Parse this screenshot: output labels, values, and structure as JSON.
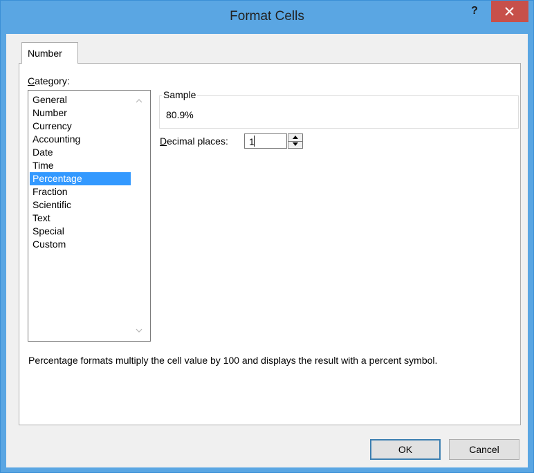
{
  "window": {
    "title": "Format Cells",
    "help_label": "?",
    "accent_color": "#5aa6e3",
    "close_color": "#c7504a"
  },
  "tabs": [
    {
      "label": "Number",
      "selected": true
    }
  ],
  "category": {
    "label": "Category:",
    "label_underlined_char": "C",
    "label_rest": "ategory:",
    "selected": "Percentage",
    "items": [
      "General",
      "Number",
      "Currency",
      "Accounting",
      "Date",
      "Time",
      "Percentage",
      "Fraction",
      "Scientific",
      "Text",
      "Special",
      "Custom"
    ]
  },
  "sample": {
    "legend": "Sample",
    "value": "80.9%"
  },
  "decimal_places": {
    "label_underlined_char": "D",
    "label_rest": "ecimal places:",
    "value": "1"
  },
  "description": "Percentage formats multiply the cell value by 100 and displays the result with a percent symbol.",
  "buttons": {
    "ok": "OK",
    "cancel": "Cancel"
  }
}
